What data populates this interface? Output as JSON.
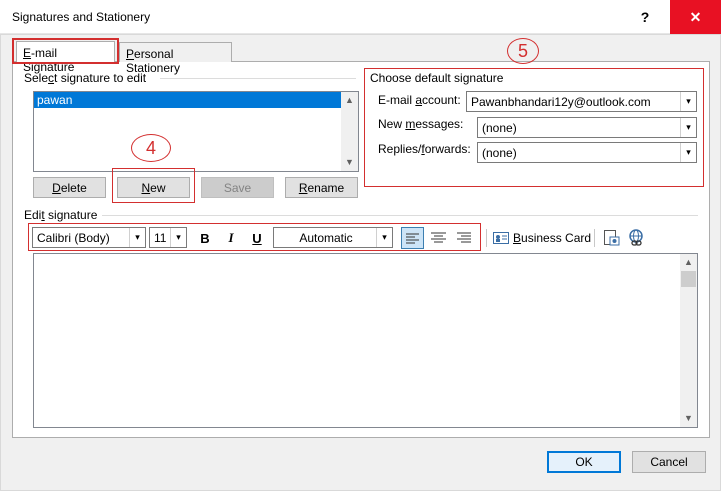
{
  "window": {
    "title": "Signatures and Stationery",
    "help_label": "?",
    "close_label": "✕"
  },
  "tabs": [
    {
      "label_acc": "E",
      "label_rest": "-mail Signature"
    },
    {
      "label_acc": "P",
      "label_rest": "ersonal Stationery"
    }
  ],
  "callouts": {
    "four": "4",
    "five": "5"
  },
  "select_signature": {
    "label_pre": "Sele",
    "label_acc": "c",
    "label_post": "t signature to edit",
    "items": [
      "pawan"
    ]
  },
  "buttons": {
    "delete": {
      "acc": "D",
      "rest": "elete"
    },
    "new": {
      "acc": "N",
      "rest": "ew"
    },
    "save": {
      "acc": "",
      "rest": "Save"
    },
    "rename": {
      "acc": "R",
      "rest": "ename"
    },
    "ok": "OK",
    "cancel": "Cancel"
  },
  "default_signature": {
    "title": "Choose default signature",
    "email_label_pre": "E-mail ",
    "email_label_acc": "a",
    "email_label_post": "ccount:",
    "email_value": "Pawanbhandari12y@outlook.com",
    "new_label_pre": "New ",
    "new_label_acc": "m",
    "new_label_post": "essages:",
    "new_value": "(none)",
    "replies_label_pre": "Replies/",
    "replies_label_acc": "f",
    "replies_label_post": "orwards:",
    "replies_value": "(none)"
  },
  "edit_signature": {
    "label_pre": "Edi",
    "label_acc": "t",
    "label_post": " signature",
    "font": "Calibri (Body)",
    "size": "11",
    "bold": "B",
    "italic": "I",
    "underline": "U",
    "color": "Automatic",
    "business_card_acc": "B",
    "business_card_rest": "usiness Card"
  },
  "icons": {
    "down_arrow": "▾",
    "up_arrow": "▲",
    "small_down": "▼"
  }
}
